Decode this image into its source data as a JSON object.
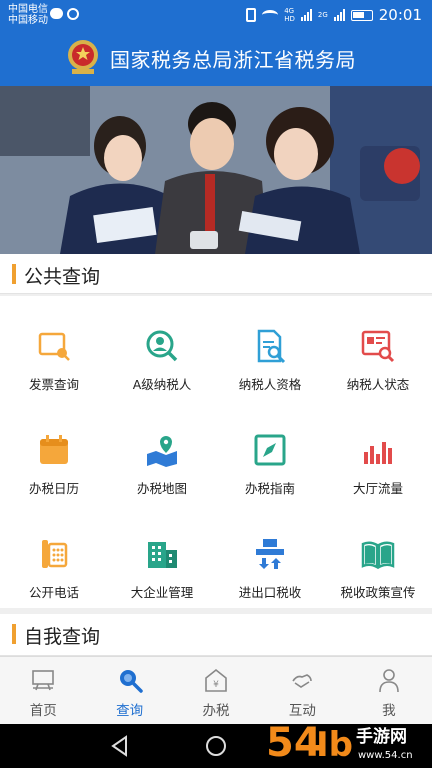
{
  "status_bar": {
    "carrier_1": "中国电信",
    "carrier_2": "中国移动",
    "network_top": "4G",
    "network_bottom": "HD",
    "network2": "2G",
    "time": "20:01"
  },
  "header": {
    "title": "国家税务总局浙江省税务局",
    "emblem_icon": "national-emblem-icon"
  },
  "sections": {
    "public_query": "公共查询",
    "self_query": "自我查询"
  },
  "grid_items": [
    {
      "label": "发票查询",
      "icon": "invoice-search-icon"
    },
    {
      "label": "A级纳税人",
      "icon": "grade-a-taxpayer-icon"
    },
    {
      "label": "纳税人资格",
      "icon": "taxpayer-qualification-icon"
    },
    {
      "label": "纳税人状态",
      "icon": "taxpayer-status-icon"
    },
    {
      "label": "办税日历",
      "icon": "calendar-icon"
    },
    {
      "label": "办税地图",
      "icon": "map-icon"
    },
    {
      "label": "办税指南",
      "icon": "compass-icon"
    },
    {
      "label": "大厅流量",
      "icon": "bar-chart-icon"
    },
    {
      "label": "公开电话",
      "icon": "phone-icon"
    },
    {
      "label": "大企业管理",
      "icon": "building-icon"
    },
    {
      "label": "进出口税收",
      "icon": "import-export-icon"
    },
    {
      "label": "税收政策宣传",
      "icon": "book-icon"
    }
  ],
  "tabs": [
    {
      "label": "首页",
      "icon": "home-icon",
      "active": false
    },
    {
      "label": "查询",
      "icon": "search-icon",
      "active": true
    },
    {
      "label": "办税",
      "icon": "tax-office-icon",
      "active": false
    },
    {
      "label": "互动",
      "icon": "interaction-icon",
      "active": false
    },
    {
      "label": "我",
      "icon": "profile-icon",
      "active": false
    }
  ],
  "watermark": {
    "digits": "54",
    "mark": "Ib",
    "text_top": "手游网",
    "text_bottom": "www.54.cn"
  },
  "colors": {
    "brand_blue": "#1f6fd0",
    "accent_orange": "#f0a030",
    "icon_orange": "#f5a73b",
    "icon_teal": "#29a58a",
    "icon_blue": "#2f7bd6",
    "icon_red": "#e24b4b"
  }
}
